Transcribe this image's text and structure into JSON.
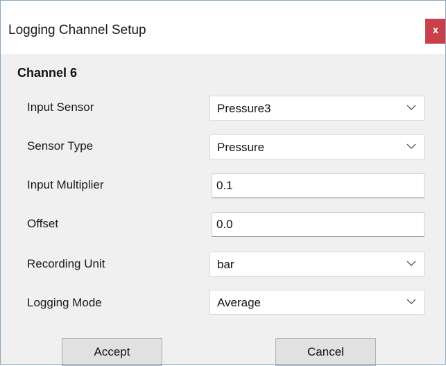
{
  "window": {
    "title": "Logging Channel Setup",
    "close_label": "x"
  },
  "channel": {
    "title": "Channel 6"
  },
  "fields": {
    "input_sensor": {
      "label": "Input Sensor",
      "value": "Pressure3"
    },
    "sensor_type": {
      "label": "Sensor Type",
      "value": "Pressure"
    },
    "input_multiplier": {
      "label": "Input Multiplier",
      "value": "0.1"
    },
    "offset": {
      "label": "Offset",
      "value": "0.0"
    },
    "recording_unit": {
      "label": "Recording Unit",
      "value": "bar"
    },
    "logging_mode": {
      "label": "Logging Mode",
      "value": "Average"
    }
  },
  "buttons": {
    "accept": "Accept",
    "cancel": "Cancel"
  },
  "colors": {
    "close_button": "#c9404a",
    "window_body": "#f0f0f0",
    "titlebar": "#ffffff"
  },
  "icons": {
    "dropdown": "chevron-down-icon",
    "close": "close-icon"
  }
}
